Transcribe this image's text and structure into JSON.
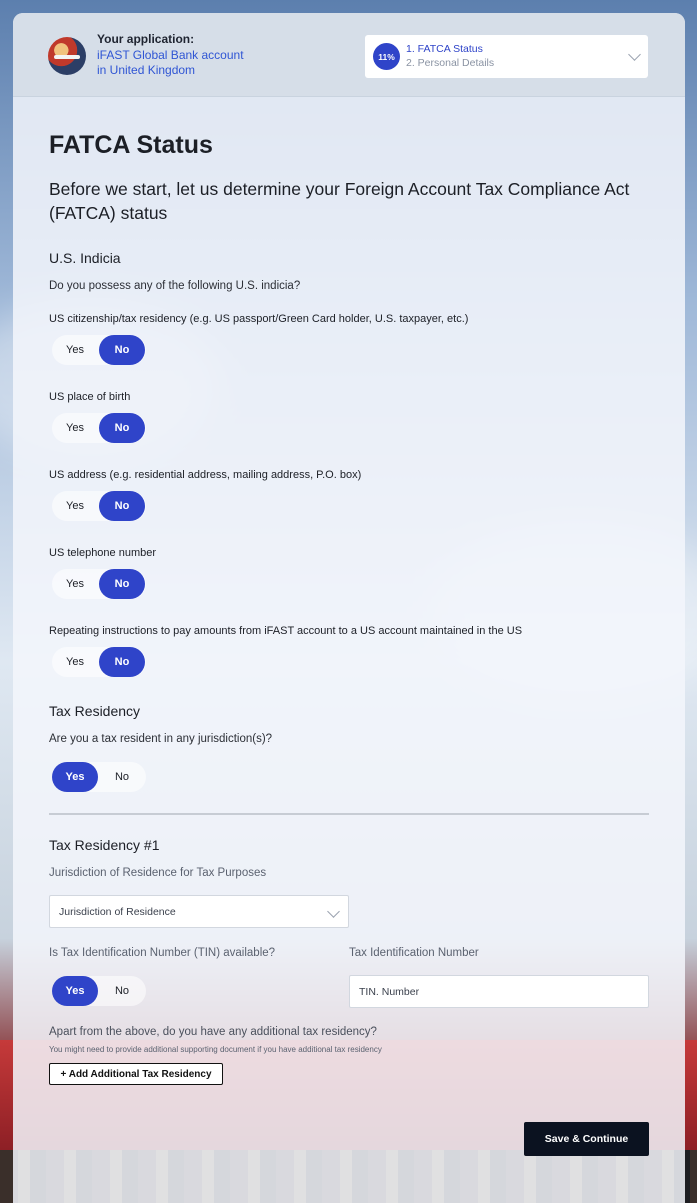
{
  "header": {
    "app_label": "Your application:",
    "app_name_line1": "iFAST Global Bank account",
    "app_name_line2": "in United Kingdom",
    "progress_percent": "11%",
    "step_current": "1. FATCA Status",
    "step_next": "2. Personal Details"
  },
  "page": {
    "title": "FATCA Status",
    "lead": "Before we start, let us determine your Foreign Account Tax Compliance Act (FATCA) status"
  },
  "us_indicia": {
    "heading": "U.S. Indicia",
    "question": "Do you possess any of the following U.S. indicia?",
    "items": [
      {
        "label": "US citizenship/tax residency (e.g. US passport/Green Card holder, U.S. taxpayer, etc.)",
        "yes": "Yes",
        "no": "No",
        "selected": "No"
      },
      {
        "label": "US place of birth",
        "yes": "Yes",
        "no": "No",
        "selected": "No"
      },
      {
        "label": "US address (e.g. residential address, mailing address, P.O. box)",
        "yes": "Yes",
        "no": "No",
        "selected": "No"
      },
      {
        "label": "US telephone number",
        "yes": "Yes",
        "no": "No",
        "selected": "No"
      },
      {
        "label": "Repeating instructions to pay amounts from iFAST account to a US account maintained in the US",
        "yes": "Yes",
        "no": "No",
        "selected": "No"
      }
    ]
  },
  "tax_residency": {
    "heading": "Tax Residency",
    "question": "Are you a tax resident in any jurisdiction(s)?",
    "yes": "Yes",
    "no": "No",
    "selected": "Yes"
  },
  "tax_residency_1": {
    "heading": "Tax Residency #1",
    "jurisdiction_label": "Jurisdiction of Residence for Tax Purposes",
    "jurisdiction_value": "Jurisdiction of Residence",
    "tin_question": "Is Tax Identification Number (TIN) available?",
    "tin_yes": "Yes",
    "tin_no": "No",
    "tin_selected": "Yes",
    "tin_label": "Tax Identification Number",
    "tin_placeholder": "TIN. Number"
  },
  "additional": {
    "question": "Apart from the above, do you have any additional tax residency?",
    "note": "You might need to provide additional supporting document if you have additional tax residency",
    "add_button": "+ Add Additional Tax Residency"
  },
  "footer": {
    "save_button": "Save & Continue"
  },
  "colors": {
    "primary": "#2f44c9",
    "link": "#2f55d4",
    "dark_button": "#0b1220"
  }
}
